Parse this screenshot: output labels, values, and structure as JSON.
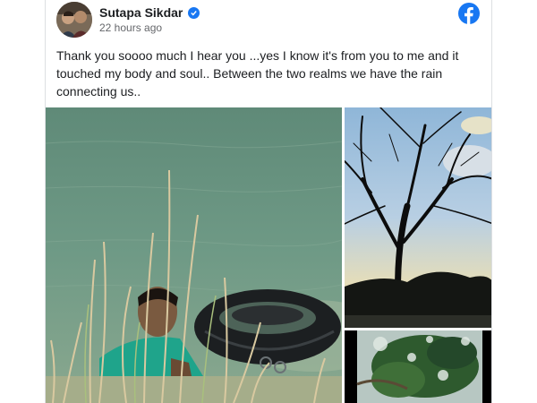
{
  "post": {
    "author": "Sutapa Sikdar",
    "timestamp": "22 hours ago",
    "text": "Thank you soooo much I hear you ...yes I know it's from you to me and it touched my body and soul.. Between the two realms we have the rain connecting us.."
  },
  "icons": {
    "verified": "verified-badge-icon",
    "platform": "facebook-logo-icon"
  },
  "colors": {
    "brand_blue": "#1877f2",
    "text_primary": "#1c1e21",
    "text_secondary": "#65676b"
  }
}
